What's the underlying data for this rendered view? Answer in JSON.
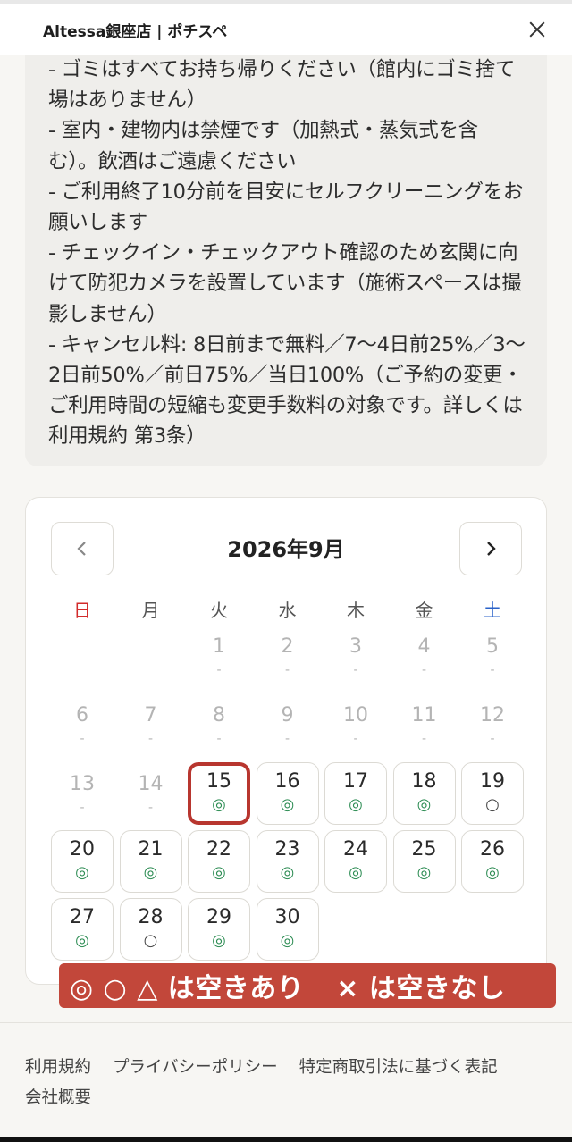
{
  "header": {
    "title": "Altessa銀座店 | ポチスペ",
    "close_icon": "close-icon"
  },
  "notes": {
    "lines": [
      "- ゴミはすべてお持ち帰りください（館内にゴミ捨て場はありません）",
      "- 室内・建物内は禁煙です（加熱式・蒸気式を含む）。飲酒はご遠慮ください",
      "- ご利用終了10分前を目安にセルフクリーニングをお願いします",
      "- チェックイン・チェックアウト確認のため玄関に向けて防犯カメラを設置しています（施術スペースは撮影しません）",
      "- キャンセル料: 8日前まで無料／7〜4日前25%／3〜2日前50%／前日75%／当日100%（ご予約の変更・ご利用時間の短縮も変更手数料の対象です。詳しくは利用規約 第3条）"
    ]
  },
  "calendar": {
    "month_label": "2026年9月",
    "prev_icon": "chevron-left-icon",
    "next_icon": "chevron-right-icon",
    "weekdays": [
      "日",
      "月",
      "火",
      "水",
      "木",
      "金",
      "土"
    ],
    "days": [
      {
        "num": "1",
        "mark": "-",
        "status": "disabled"
      },
      {
        "num": "2",
        "mark": "-",
        "status": "disabled"
      },
      {
        "num": "3",
        "mark": "-",
        "status": "disabled"
      },
      {
        "num": "4",
        "mark": "-",
        "status": "disabled"
      },
      {
        "num": "5",
        "mark": "-",
        "status": "disabled"
      },
      {
        "num": "6",
        "mark": "-",
        "status": "disabled"
      },
      {
        "num": "7",
        "mark": "-",
        "status": "disabled"
      },
      {
        "num": "8",
        "mark": "-",
        "status": "disabled"
      },
      {
        "num": "9",
        "mark": "-",
        "status": "disabled"
      },
      {
        "num": "10",
        "mark": "-",
        "status": "disabled"
      },
      {
        "num": "11",
        "mark": "-",
        "status": "disabled"
      },
      {
        "num": "12",
        "mark": "-",
        "status": "disabled"
      },
      {
        "num": "13",
        "mark": "-",
        "status": "disabled"
      },
      {
        "num": "14",
        "mark": "-",
        "status": "disabled"
      },
      {
        "num": "15",
        "mark": "◎",
        "status": "selected"
      },
      {
        "num": "16",
        "mark": "◎",
        "status": "available"
      },
      {
        "num": "17",
        "mark": "◎",
        "status": "available"
      },
      {
        "num": "18",
        "mark": "◎",
        "status": "available"
      },
      {
        "num": "19",
        "mark": "○",
        "status": "available"
      },
      {
        "num": "20",
        "mark": "◎",
        "status": "available"
      },
      {
        "num": "21",
        "mark": "◎",
        "status": "available"
      },
      {
        "num": "22",
        "mark": "◎",
        "status": "available"
      },
      {
        "num": "23",
        "mark": "◎",
        "status": "available"
      },
      {
        "num": "24",
        "mark": "◎",
        "status": "available"
      },
      {
        "num": "25",
        "mark": "◎",
        "status": "available"
      },
      {
        "num": "26",
        "mark": "◎",
        "status": "available"
      },
      {
        "num": "27",
        "mark": "◎",
        "status": "available"
      },
      {
        "num": "28",
        "mark": "○",
        "status": "available"
      },
      {
        "num": "29",
        "mark": "◎",
        "status": "available"
      },
      {
        "num": "30",
        "mark": "◎",
        "status": "available"
      }
    ],
    "first_weekday": 2
  },
  "legend": {
    "available_text": "◎ ○ △ は空きあり",
    "unavailable_text": "× は空きなし"
  },
  "footer": {
    "links": [
      "利用規約",
      "プライバシーポリシー",
      "特定商取引法に基づく表記",
      "会社概要"
    ]
  },
  "colors": {
    "accent": "#c2473a",
    "available_mark": "#2c8c53",
    "sunday": "#d22b2b",
    "saturday": "#2a62c9"
  }
}
